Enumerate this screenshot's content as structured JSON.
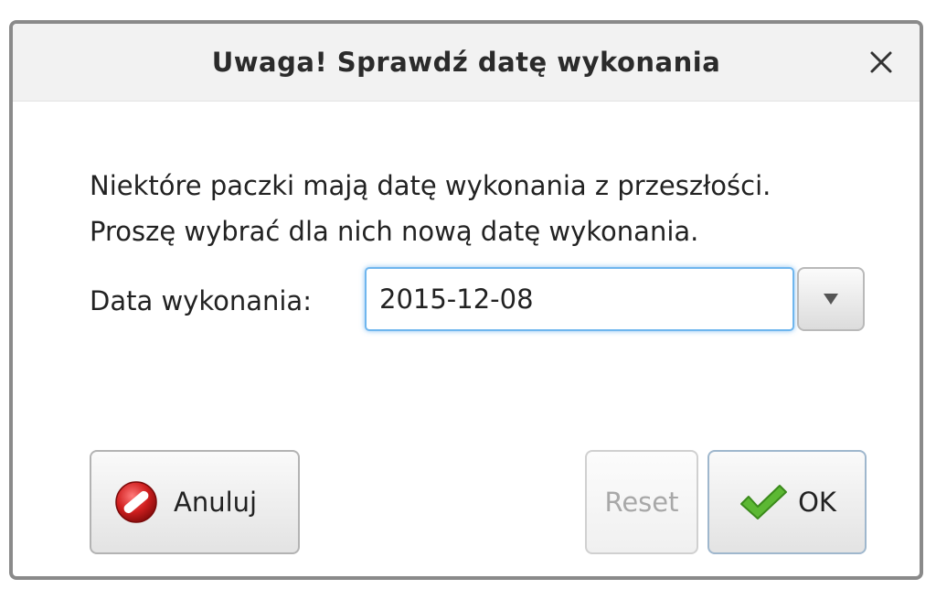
{
  "dialog": {
    "title": "Uwaga! Sprawdź datę wykonania",
    "message_line1": "Niektóre paczki mają datę wykonania z przeszłości.",
    "message_line2": "Proszę wybrać dla nich nową datę wykonania.",
    "date_label": "Data wykonania:",
    "date_value": "2015-12-08"
  },
  "buttons": {
    "cancel_label": "Anuluj",
    "reset_label": "Reset",
    "ok_label": "OK"
  },
  "icons": {
    "close": "close-icon",
    "dropdown": "triangle-down-icon",
    "cancel": "cancel-icon",
    "ok": "checkmark-icon"
  },
  "colors": {
    "input_focus": "#6fb6ee",
    "cancel_icon": "#d01f1f",
    "ok_icon": "#5cb833",
    "disabled_text": "#a8a8a8"
  }
}
